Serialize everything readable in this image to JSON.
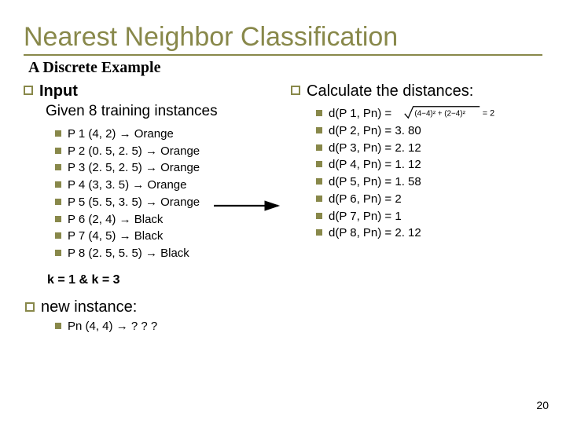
{
  "title": "Nearest Neighbor Classification",
  "subtitle": "A Discrete Example",
  "left": {
    "input_label": "Input",
    "input_body": "Given 8 training instances",
    "instances": [
      "P 1 (4, 2) → Orange",
      "P 2 (0. 5, 2. 5) → Orange",
      "P 3 (2. 5, 2. 5) → Orange",
      "P 4 (3, 3. 5) → Orange",
      "P 5 (5. 5, 3. 5) → Orange",
      "P 6 (2, 4) → Black",
      "P 7 (4, 5) → Black",
      "P 8 (2. 5, 5. 5) → Black"
    ],
    "k_line": "k = 1 & k = 3",
    "new_label": "new",
    "new_rest": " instance:",
    "new_item": "Pn (4, 4) → ? ? ?"
  },
  "right": {
    "calc_label": "Calculate the distances:",
    "distances": [
      {
        "lhs": "d(P 1, Pn) = ",
        "rhs_formula": true
      },
      {
        "lhs": "d(P 2, Pn) = 3. 80"
      },
      {
        "lhs": "d(P 3, Pn) = 2. 12"
      },
      {
        "lhs": "d(P 4, Pn) = 1. 12"
      },
      {
        "lhs": "d(P 5, Pn) = 1. 58"
      },
      {
        "lhs": "d(P 6, Pn) = 2"
      },
      {
        "lhs": "d(P 7, Pn) = 1"
      },
      {
        "lhs": "d(P 8, Pn) = 2. 12"
      }
    ]
  },
  "page_number": "20"
}
